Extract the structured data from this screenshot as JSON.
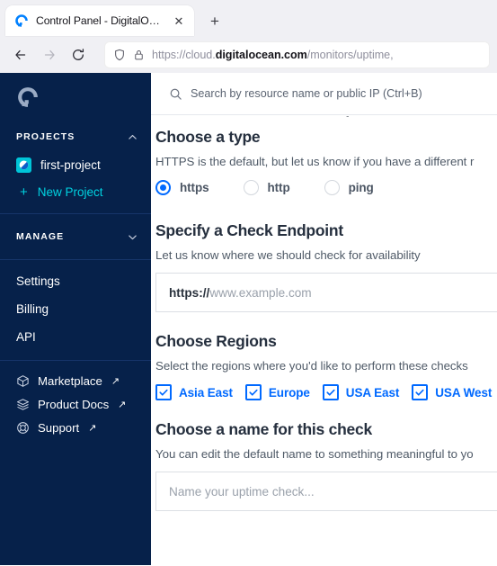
{
  "browser": {
    "tab": {
      "title": "Control Panel - DigitalOcean",
      "favicon_name": "digitalocean-favicon",
      "close_label": "✕"
    },
    "new_tab_label": "+",
    "nav": {
      "back_label": "Back",
      "forward_label": "Forward",
      "reload_label": "Reload"
    },
    "url": {
      "prefix": "https://cloud.",
      "domain": "digitalocean.com",
      "path": "/monitors/uptime,"
    }
  },
  "sidebar": {
    "logo_name": "digitalocean-logo",
    "projects": {
      "header": "PROJECTS",
      "items": [
        {
          "label": "first-project"
        }
      ],
      "new_project": "New Project",
      "new_project_plus": "+"
    },
    "manage": {
      "header": "MANAGE"
    },
    "links": [
      {
        "label": "Settings"
      },
      {
        "label": "Billing"
      },
      {
        "label": "API"
      }
    ],
    "external": [
      {
        "label": "Marketplace",
        "icon": "cube-icon",
        "arrow": "↗"
      },
      {
        "label": "Product Docs",
        "icon": "layers-icon",
        "arrow": "↗"
      },
      {
        "label": "Support",
        "icon": "lifebuoy-icon",
        "arrow": "↗"
      }
    ]
  },
  "search": {
    "placeholder": "Search by resource name or public IP (Ctrl+B)"
  },
  "form": {
    "clipped_heading_above": "Create an Uptime Check",
    "type": {
      "heading": "Choose a type",
      "description": "HTTPS is the default, but let us know if you have a different r",
      "options": [
        {
          "label": "https",
          "selected": true
        },
        {
          "label": "http",
          "selected": false
        },
        {
          "label": "ping",
          "selected": false
        }
      ]
    },
    "endpoint": {
      "heading": "Specify a Check Endpoint",
      "description": "Let us know where we should check for availability",
      "prefix": "https://",
      "placeholder": "www.example.com",
      "value": ""
    },
    "regions": {
      "heading": "Choose Regions",
      "description": "Select the regions where you'd like to perform these checks",
      "items": [
        {
          "label": "Asia East",
          "checked": true
        },
        {
          "label": "Europe",
          "checked": true
        },
        {
          "label": "USA East",
          "checked": true
        },
        {
          "label": "USA West",
          "checked": true
        }
      ]
    },
    "name": {
      "heading": "Choose a name for this check",
      "description": "You can edit the default name to something meaningful to yo",
      "placeholder": "Name your uptime check...",
      "value": ""
    }
  },
  "colors": {
    "sidebar_bg": "#06214a",
    "accent_blue": "#0069ff",
    "accent_cyan": "#00d2e0",
    "heading": "#252f3e"
  }
}
